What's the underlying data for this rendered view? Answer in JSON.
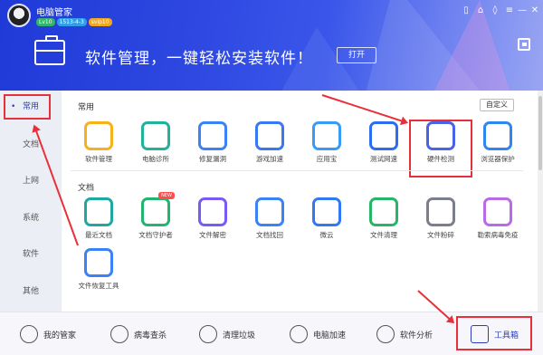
{
  "window": {
    "app_name": "电脑管家",
    "badges": {
      "level": "Lv10",
      "qq": "1513-4-3",
      "vip": "svip10"
    },
    "controls": [
      "phone-icon",
      "shirt-icon",
      "shield-icon",
      "menu-icon",
      "minimize-icon",
      "close-icon"
    ]
  },
  "banner": {
    "headline": "软件管理，一键轻松安装软件！",
    "open_button": "打开"
  },
  "sidebar": {
    "items": [
      {
        "label": "常用",
        "active": true
      },
      {
        "label": "文档",
        "active": false
      },
      {
        "label": "上网",
        "active": false
      },
      {
        "label": "系统",
        "active": false
      },
      {
        "label": "软件",
        "active": false
      },
      {
        "label": "其他",
        "active": false
      }
    ]
  },
  "sections": {
    "common": {
      "title": "常用",
      "custom_button": "自定义",
      "tools": [
        {
          "label": "软件管理",
          "icon": "pinwheel-icon",
          "color": "#f7b11b"
        },
        {
          "label": "电脑诊所",
          "icon": "stethoscope-icon",
          "color": "#1fb39a"
        },
        {
          "label": "修复漏洞",
          "icon": "windows-repair-icon",
          "color": "#3b82f6"
        },
        {
          "label": "游戏加速",
          "icon": "rocket-icon",
          "color": "#3a78f2"
        },
        {
          "label": "应用宝",
          "icon": "app-store-icon",
          "color": "#3a9bf5"
        },
        {
          "label": "测试网速",
          "icon": "speedometer-icon",
          "color": "#2d6ef0"
        },
        {
          "label": "硬件检测",
          "icon": "chip-search-icon",
          "color": "#4a63e6"
        },
        {
          "label": "浏览器保护",
          "icon": "browser-shield-icon",
          "color": "#2f86f0"
        }
      ]
    },
    "docs": {
      "title": "文档",
      "tools": [
        {
          "label": "最近文档",
          "icon": "layers-icon",
          "color": "#1fa8a0"
        },
        {
          "label": "文档守护者",
          "icon": "doc-guard-icon",
          "color": "#21b56f",
          "tag": "NEW"
        },
        {
          "label": "文件解密",
          "icon": "folder-lock-icon",
          "color": "#7a5af5"
        },
        {
          "label": "文档找回",
          "icon": "doc-search-icon",
          "color": "#3b82f6"
        },
        {
          "label": "微云",
          "icon": "cloud-icon",
          "color": "#2f7af0"
        },
        {
          "label": "文件清理",
          "icon": "file-clean-icon",
          "color": "#27b56a"
        },
        {
          "label": "文件粉碎",
          "icon": "shredder-icon",
          "color": "#7b7f8c"
        },
        {
          "label": "勒索病毒免疫",
          "icon": "virus-immunity-icon",
          "color": "#b86ae8"
        },
        {
          "label": "文件恢复工具",
          "icon": "history-restore-icon",
          "color": "#3b82f6"
        }
      ]
    }
  },
  "bottom_nav": [
    {
      "label": "我的管家",
      "icon": "user-icon",
      "active": false
    },
    {
      "label": "病毒查杀",
      "icon": "virus-scan-icon",
      "active": false
    },
    {
      "label": "清理垃圾",
      "icon": "broom-icon",
      "active": false
    },
    {
      "label": "电脑加速",
      "icon": "rocket-nav-icon",
      "active": false
    },
    {
      "label": "软件分析",
      "icon": "analysis-icon",
      "active": false
    },
    {
      "label": "工具箱",
      "icon": "toolbox-icon",
      "active": true
    }
  ]
}
